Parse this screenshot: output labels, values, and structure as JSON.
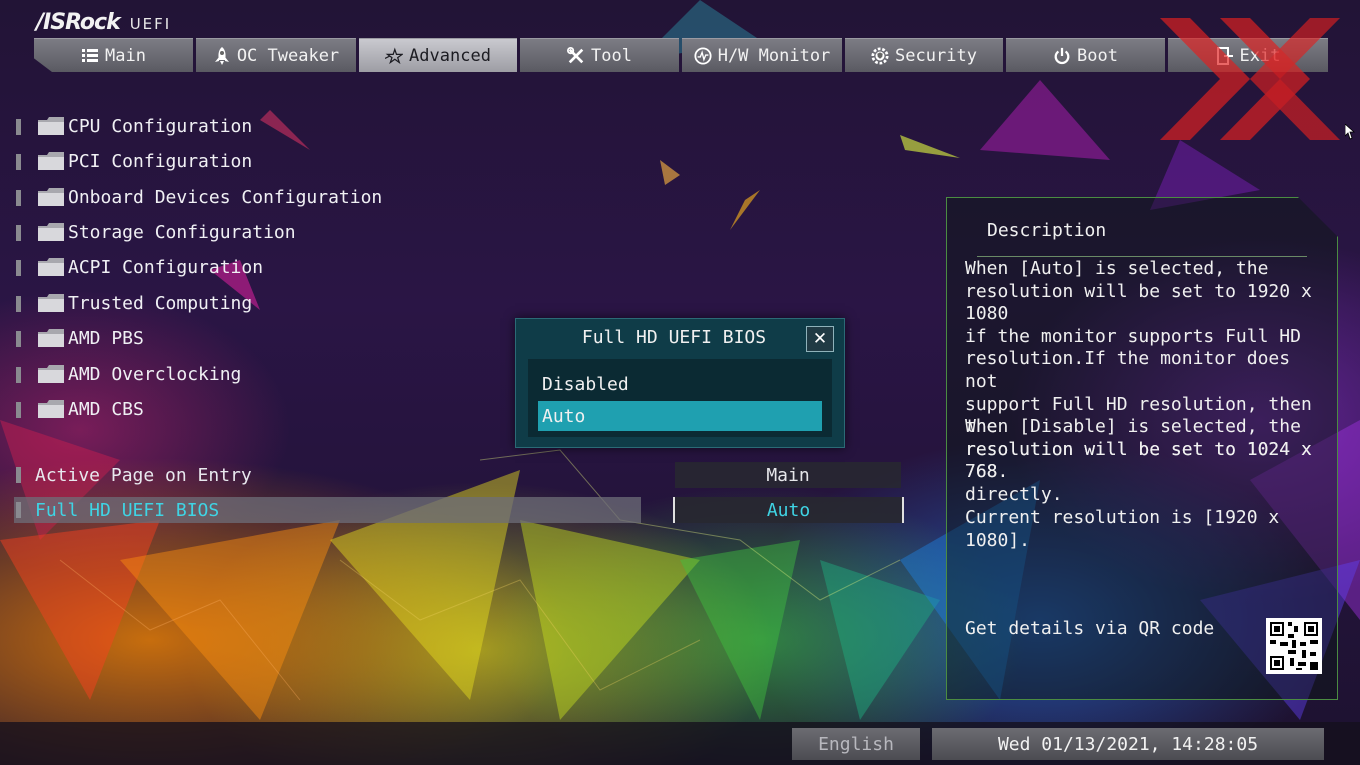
{
  "logo": {
    "brand": "/ISRock",
    "subtitle": "UEFI"
  },
  "tabs": [
    {
      "label": "Main",
      "icon": "list-icon"
    },
    {
      "label": "OC Tweaker",
      "icon": "rocket-icon"
    },
    {
      "label": "Advanced",
      "icon": "star-icon"
    },
    {
      "label": "Tool",
      "icon": "tools-icon"
    },
    {
      "label": "H/W Monitor",
      "icon": "monitor-icon"
    },
    {
      "label": "Security",
      "icon": "shield-gear-icon"
    },
    {
      "label": "Boot",
      "icon": "power-icon"
    },
    {
      "label": "Exit",
      "icon": "exit-icon"
    }
  ],
  "active_tab": "Advanced",
  "submenus": [
    {
      "label": "CPU Configuration"
    },
    {
      "label": "PCI Configuration"
    },
    {
      "label": "Onboard Devices Configuration"
    },
    {
      "label": "Storage Configuration"
    },
    {
      "label": "ACPI Configuration"
    },
    {
      "label": "Trusted Computing"
    },
    {
      "label": "AMD PBS"
    },
    {
      "label": "AMD Overclocking"
    },
    {
      "label": "AMD CBS"
    }
  ],
  "settings": [
    {
      "label": "Active Page on Entry",
      "value": "Main"
    },
    {
      "label": "Full HD UEFI BIOS",
      "value": "Auto"
    }
  ],
  "popup": {
    "title": "Full HD UEFI BIOS",
    "options": [
      "Disabled",
      "Auto"
    ],
    "selected": "Auto"
  },
  "description": {
    "heading": "Description",
    "para1": "When [Auto] is selected, the\nresolution will be set to 1920 x 1080\nif the monitor supports Full HD\nresolution.If the monitor does not\nsupport Full HD resolution, then the\nresolution will be set to 1024 x 768.",
    "para2": "When [Disable] is selected, the\nresolution will be set to 1024 x 768\ndirectly.",
    "para3": "Current resolution is [1920 x 1080].",
    "qr_label": "Get details via QR code"
  },
  "footer": {
    "language": "English",
    "datetime": "Wed 01/13/2021, 14:28:05"
  },
  "colors": {
    "accent": "#3fd4e4",
    "popup_bg": "#0f3c48",
    "popup_selected": "#1fa0b0",
    "watermark": "#e02020"
  }
}
